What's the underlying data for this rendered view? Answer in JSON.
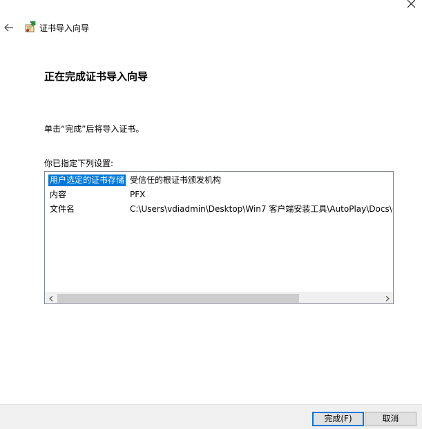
{
  "window": {
    "title": "证书导入向导"
  },
  "page": {
    "heading": "正在完成证书导入向导",
    "instruction": "单击“完成”后将导入证书。",
    "settings_label": "你已指定下列设置:"
  },
  "settings": {
    "rows": [
      {
        "name": "用户选定的证书存储",
        "value": "受信任的根证书颁发机构",
        "selected": true
      },
      {
        "name": "内容",
        "value": "PFX",
        "selected": false
      },
      {
        "name": "文件名",
        "value": "C:\\Users\\vdiadmin\\Desktop\\Win7 客户端安装工具\\AutoPlay\\Docs\\(",
        "selected": false
      }
    ]
  },
  "scrollbar": {
    "left_arrow": "<",
    "right_arrow": ">"
  },
  "buttons": {
    "finish": "完成(F)",
    "cancel": "取消"
  },
  "icons": {
    "close": "close-icon",
    "back": "back-arrow-icon",
    "wizard": "certificate-wizard-icon"
  },
  "colors": {
    "selection": "#0078d7",
    "footer": "#f0f0f0",
    "button": "#e1e1e1",
    "scroll_thumb": "#cdcdcd"
  }
}
